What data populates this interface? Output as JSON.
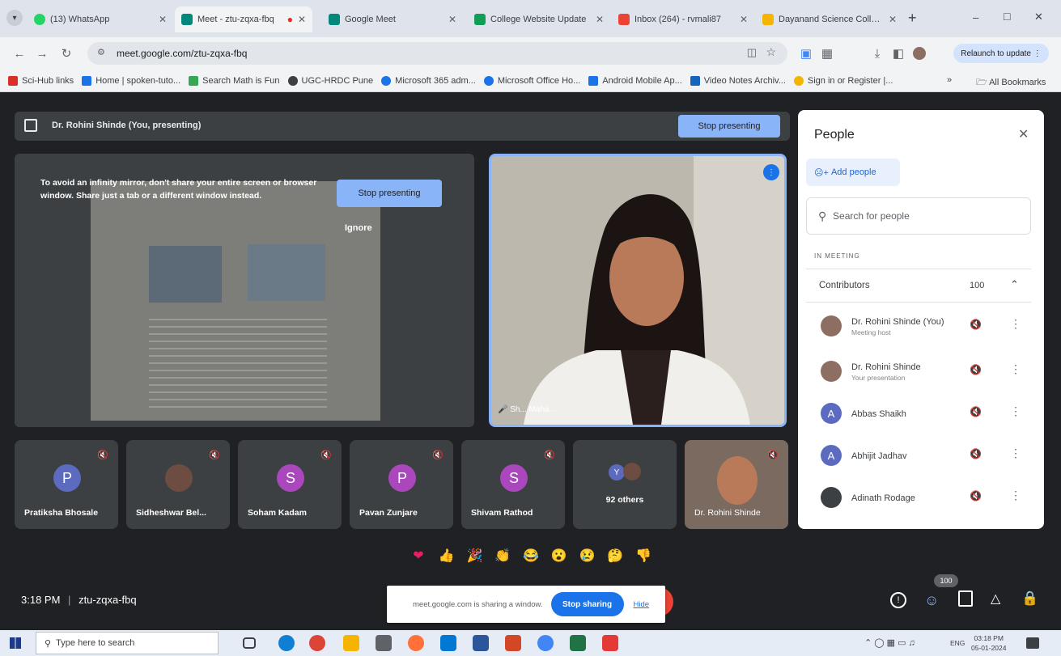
{
  "browser": {
    "tabs": [
      {
        "label": "(13) WhatsApp",
        "color": "#25d366",
        "active": false
      },
      {
        "label": "Meet - ztu-zqxa-fbq",
        "color": "#00897b",
        "active": true
      },
      {
        "label": "Google Meet",
        "color": "#00897b",
        "active": false
      },
      {
        "label": "College Website Update",
        "color": "#0f9d58",
        "active": false
      },
      {
        "label": "Inbox (264) - rvmali87",
        "color": "#ea4335",
        "active": false
      },
      {
        "label": "Dayanand Science College",
        "color": "#f4b400",
        "active": false
      }
    ],
    "new_tab": "+",
    "window_controls": [
      "–",
      "□",
      "✕"
    ],
    "url": "meet.google.com/ztu-zqxa-fbq",
    "relaunch_label": "Relaunch to update",
    "bookmarks": [
      {
        "label": "Sci-Hub links",
        "color": "#d93025"
      },
      {
        "label": "Home | spoken-tuto...",
        "color": "#1a73e8"
      },
      {
        "label": "Search Math is Fun",
        "color": "#34a853"
      },
      {
        "label": "UGC-HRDC Pune",
        "color": "#3c4043"
      },
      {
        "label": "Microsoft 365 adm...",
        "color": "#1a73e8"
      },
      {
        "label": "Microsoft Office Ho...",
        "color": "#1a73e8"
      },
      {
        "label": "Android Mobile Ap...",
        "color": "#1a73e8"
      },
      {
        "label": "Video Notes Archiv...",
        "color": "#1565c0"
      },
      {
        "label": "Sign in or Register |...",
        "color": "#f4b400"
      }
    ],
    "all_bookmarks": "All Bookmarks"
  },
  "presenting_bar": {
    "label": "Dr. Rohini Shinde (You, presenting)",
    "stop_label": "Stop presenting"
  },
  "share_tile": {
    "warning": "To avoid an infinity mirror, don't share your entire screen or browser window. Share just a tab or a different window instead.",
    "stop_label": "Stop presenting",
    "ignore_label": "Ignore"
  },
  "main_video": {
    "name_tag": "Sh... Maha..."
  },
  "participants": [
    {
      "name": "Pratiksha Bhosale",
      "initial": "P",
      "color": "#5c6bc0"
    },
    {
      "name": "Sidheshwar Bel...",
      "initial": "",
      "color": "#795548"
    },
    {
      "name": "Soham Kadam",
      "initial": "S",
      "color": "#ab47bc"
    },
    {
      "name": "Pavan Zunjare",
      "initial": "P",
      "color": "#ab47bc"
    },
    {
      "name": "Shivam Rathod",
      "initial": "S",
      "color": "#ab47bc"
    },
    {
      "name": "92 others",
      "initial": "Y",
      "color": "#5c6bc0"
    },
    {
      "name": "Dr. Rohini Shinde",
      "initial": "",
      "color": "#8d6e63"
    }
  ],
  "people_panel": {
    "title": "People",
    "add_label": "Add people",
    "search_placeholder": "Search for people",
    "section_label": "IN MEETING",
    "group_label": "Contributors",
    "group_count": "100",
    "people": [
      {
        "name": "Dr. Rohini Shinde (You)",
        "sub": "Meeting host",
        "initial": "",
        "color": "#8d6e63"
      },
      {
        "name": "Dr. Rohini Shinde",
        "sub": "Your presentation",
        "initial": "",
        "color": "#8d6e63"
      },
      {
        "name": "Abbas Shaikh",
        "sub": "",
        "initial": "A",
        "color": "#5c6bc0"
      },
      {
        "name": "Abhijit Jadhav",
        "sub": "",
        "initial": "A",
        "color": "#5c6bc0"
      },
      {
        "name": "Adinath Rodage",
        "sub": "",
        "initial": "",
        "color": "#3c4043"
      }
    ]
  },
  "reactions": [
    "❤",
    "👍",
    "🎉",
    "👏",
    "😂",
    "😮",
    "😢",
    "🤔",
    "👎"
  ],
  "bottom": {
    "time": "3:18 PM",
    "separator": "|",
    "meeting_code": "ztu-zqxa-fbq",
    "participant_badge": "100"
  },
  "sharing_notice": {
    "text": "meet.google.com is sharing a window.",
    "stop_label": "Stop sharing",
    "hide_label": "Hide"
  },
  "taskbar": {
    "search_placeholder": "Type here to search",
    "lang": "ENG",
    "clock_time": "03:18 PM",
    "clock_date": "05-01-2024"
  }
}
